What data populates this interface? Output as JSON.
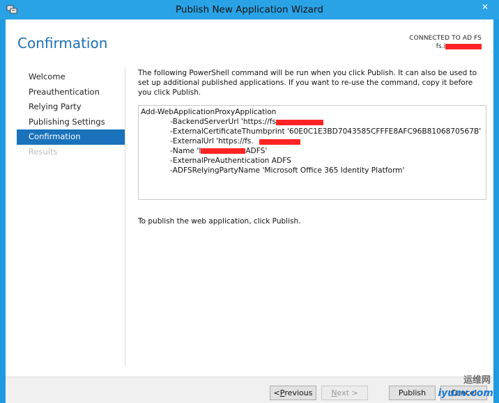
{
  "window": {
    "title": "Publish New Application Wizard",
    "close_glyph": "✕"
  },
  "header": {
    "page_title": "Confirmation",
    "connected_label": "CONNECTED TO AD FS",
    "server": "fs.i"
  },
  "nav": {
    "items": [
      {
        "label": "Welcome",
        "state": "normal"
      },
      {
        "label": "Preauthentication",
        "state": "normal"
      },
      {
        "label": "Relying Party",
        "state": "normal"
      },
      {
        "label": "Publishing Settings",
        "state": "normal"
      },
      {
        "label": "Confirmation",
        "state": "active"
      },
      {
        "label": "Results",
        "state": "disabled"
      }
    ]
  },
  "content": {
    "intro": "The following PowerShell command will be run when you click Publish. It can also be used to set up additional published applications. If you want to re-use the command, copy it before you click Publish.",
    "command": {
      "cmdlet": "Add-WebApplicationProxyApplication",
      "params": [
        "-BackendServerUrl 'https://fs",
        "-ExternalCertificateThumbprint '60E0C1E3BD7043585CFFFE8AFC96B8106870567B'",
        "-ExternalUrl 'https://fs.",
        "-Name 'l",
        "-ExternalPreAuthentication ADFS",
        "-ADFSRelyingPartyName 'Microsoft Office 365 Identity Platform'"
      ],
      "name_suffix": "ADFS'"
    },
    "publish_note": "To publish the web application, click Publish."
  },
  "footer": {
    "previous": {
      "prefix": "< ",
      "key": "P",
      "rest": "revious"
    },
    "next": {
      "key": "N",
      "rest": "ext >"
    },
    "publish": "Publish",
    "cancel": "Cancel"
  },
  "watermark": {
    "line1": "运维网",
    "line2": "iyunv.com"
  },
  "colors": {
    "accent": "#1a72bb",
    "title_blue": "#1b6fb5",
    "redaction": "#ff2424"
  }
}
